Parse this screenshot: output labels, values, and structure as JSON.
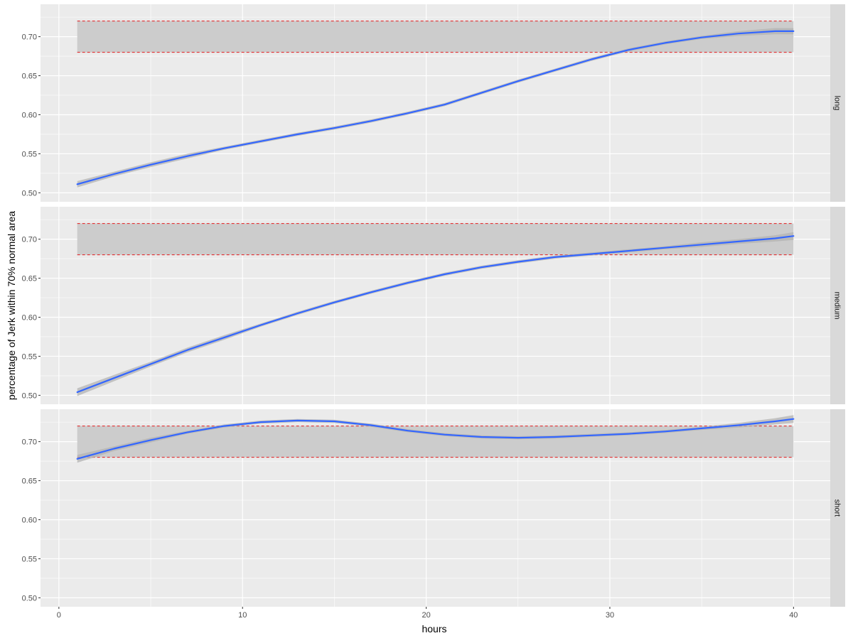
{
  "chart_data": {
    "type": "line",
    "xlabel": "hours",
    "ylabel": "percentage of Jerk within 70% normal area",
    "xlim": [
      -1.0,
      42.0
    ],
    "ylim": [
      0.4885,
      0.7415
    ],
    "x_ticks": [
      0,
      10,
      20,
      30,
      40
    ],
    "x_tick_labels": [
      "0",
      "10",
      "20",
      "30",
      "40"
    ],
    "y_ticks": [
      0.5,
      0.55,
      0.6,
      0.65,
      0.7
    ],
    "y_tick_labels": [
      "0.50",
      "0.55",
      "0.60",
      "0.65",
      "0.70"
    ],
    "reference_band": {
      "lower": 0.68,
      "upper": 0.72,
      "x_start": 1,
      "x_end": 40,
      "line_style": "dashed"
    },
    "grid": true,
    "legend": "none",
    "colors": {
      "panel_bg": "#ebebeb",
      "grid": "#ffffff",
      "strip_bg": "#d9d9d9",
      "band_fill": "#cccccc",
      "ref_line": "#e41a1c",
      "smooth_line": "#3366ff",
      "ci_fill": "#b3b3b3"
    },
    "x": [
      1,
      3,
      5,
      7,
      9,
      11,
      13,
      15,
      17,
      19,
      21,
      23,
      25,
      27,
      29,
      31,
      33,
      35,
      37,
      39,
      40
    ],
    "panels": [
      {
        "label": "long",
        "y": [
          0.511,
          0.524,
          0.536,
          0.547,
          0.557,
          0.566,
          0.575,
          0.583,
          0.592,
          0.602,
          0.613,
          0.628,
          0.643,
          0.657,
          0.671,
          0.683,
          0.692,
          0.699,
          0.704,
          0.707,
          0.707
        ],
        "ci": [
          0.004,
          0.003,
          0.003,
          0.003,
          0.002,
          0.002,
          0.002,
          0.002,
          0.002,
          0.002,
          0.002,
          0.002,
          0.002,
          0.002,
          0.002,
          0.002,
          0.002,
          0.002,
          0.003,
          0.004,
          0.004
        ]
      },
      {
        "label": "medium",
        "y": [
          0.504,
          0.522,
          0.54,
          0.558,
          0.574,
          0.59,
          0.605,
          0.619,
          0.632,
          0.644,
          0.655,
          0.664,
          0.671,
          0.677,
          0.681,
          0.685,
          0.689,
          0.693,
          0.697,
          0.701,
          0.704
        ],
        "ci": [
          0.005,
          0.004,
          0.003,
          0.003,
          0.003,
          0.002,
          0.002,
          0.002,
          0.002,
          0.002,
          0.002,
          0.002,
          0.002,
          0.002,
          0.002,
          0.002,
          0.002,
          0.003,
          0.003,
          0.004,
          0.005
        ]
      },
      {
        "label": "short",
        "y": [
          0.678,
          0.691,
          0.702,
          0.712,
          0.72,
          0.725,
          0.727,
          0.726,
          0.721,
          0.714,
          0.709,
          0.706,
          0.705,
          0.706,
          0.708,
          0.71,
          0.713,
          0.717,
          0.721,
          0.726,
          0.729
        ],
        "ci": [
          0.005,
          0.003,
          0.003,
          0.002,
          0.002,
          0.002,
          0.002,
          0.002,
          0.002,
          0.002,
          0.002,
          0.002,
          0.002,
          0.002,
          0.002,
          0.002,
          0.002,
          0.002,
          0.003,
          0.004,
          0.005
        ]
      }
    ]
  }
}
